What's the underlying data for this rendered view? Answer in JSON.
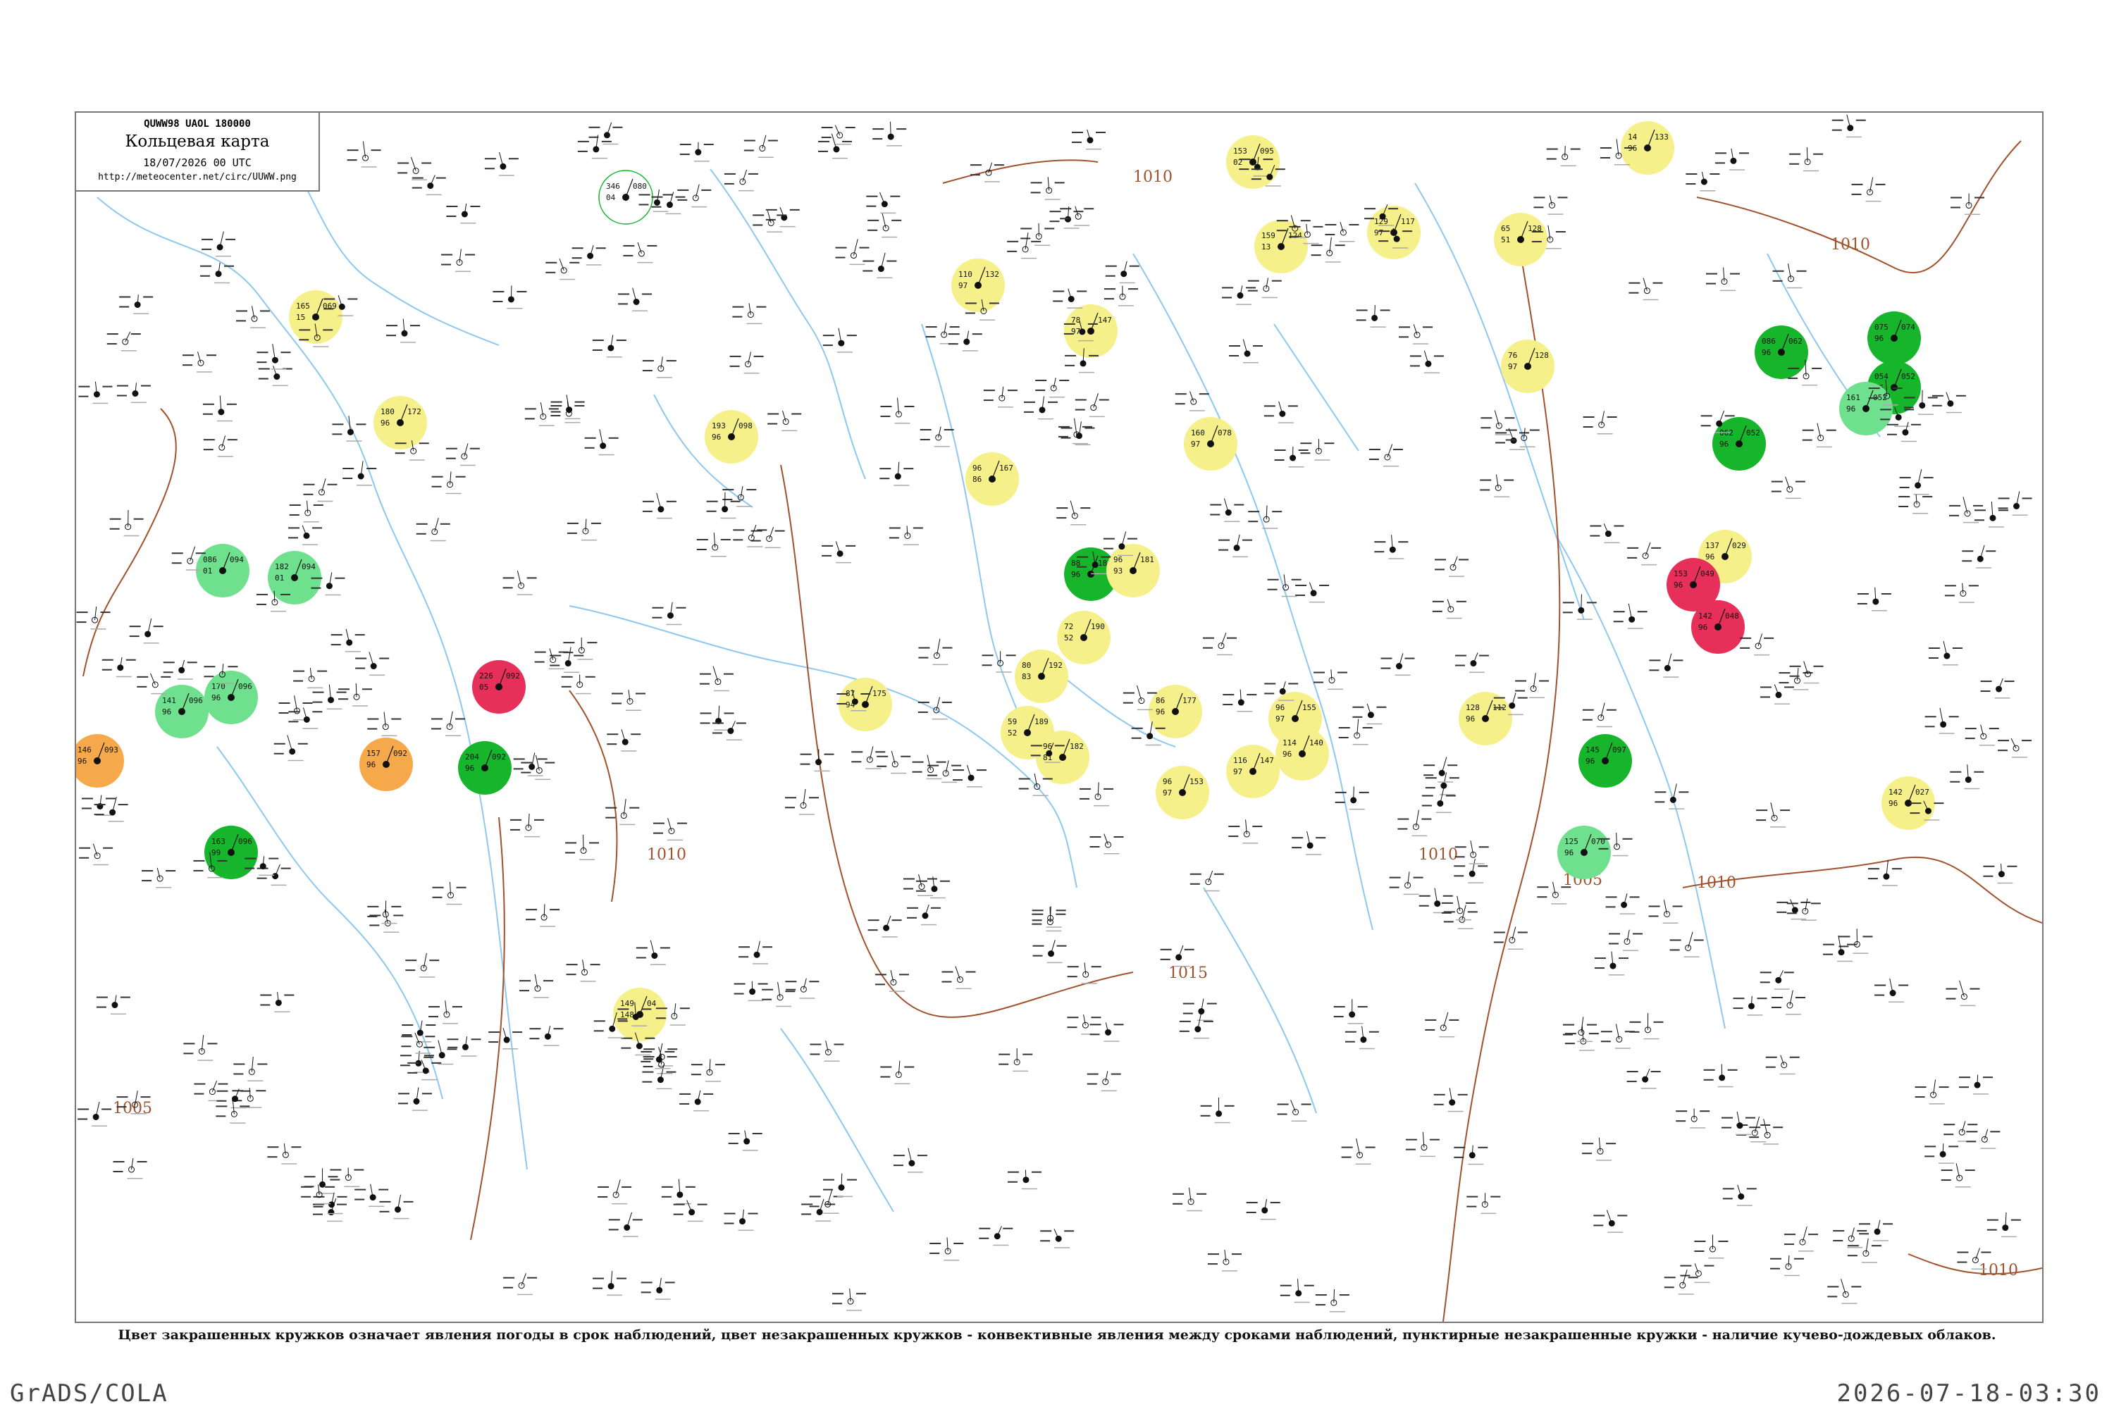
{
  "header": {
    "code": "QUWW98  UAOL  180000",
    "title": "Кольцевая карта",
    "date": "18/07/2026 00 UTC",
    "url": "http://meteocenter.net/circ/UUWW.png"
  },
  "caption": "Цвет закрашенных кружков означает явления погоды в срок наблюдений, цвет незакрашенных кружков - конвективные явления между сроками наблюдений, пунктирные незакрашенные кружки - наличие кучево-дождевых облаков.",
  "footer": {
    "left": "GrADS/COLA",
    "right": "2026-07-18-03:30"
  },
  "isobars": [
    "1010",
    "1010",
    "1005",
    "1010",
    "1015",
    "1010",
    "1005",
    "1010",
    "1010"
  ],
  "colors": {
    "yellow": "#f6f08a",
    "green": "#17b52c",
    "light_green": "#6fe08d",
    "orange": "#f6a94a",
    "red": "#e6305a",
    "isobar": "#a0522d",
    "river": "#8ec8ef"
  },
  "stations": [
    {
      "t": "165",
      "p": "069",
      "d": "15",
      "c": "yellow"
    },
    {
      "t": "180",
      "p": "172",
      "d": "96",
      "c": "yellow"
    },
    {
      "t": "346",
      "p": "080",
      "d": "04",
      "c": "none"
    },
    {
      "t": "153",
      "p": "095",
      "d": "02",
      "c": "yellow"
    },
    {
      "t": "14",
      "p": "133",
      "d": "96",
      "c": "yellow"
    },
    {
      "t": "159",
      "p": "124",
      "d": "13",
      "c": "yellow"
    },
    {
      "t": "129",
      "p": "117",
      "d": "97",
      "c": "yellow"
    },
    {
      "t": "65",
      "p": "128",
      "d": "51",
      "c": "yellow"
    },
    {
      "t": "110",
      "p": "132",
      "d": "97",
      "c": "yellow"
    },
    {
      "t": "78",
      "p": "147",
      "d": "97",
      "c": "yellow"
    },
    {
      "t": "193",
      "p": "098",
      "d": "96",
      "c": "yellow"
    },
    {
      "t": "88",
      "p": "182",
      "d": "96",
      "c": "green"
    },
    {
      "t": "086",
      "p": "094",
      "d": "01",
      "c": "light_green"
    },
    {
      "t": "182",
      "p": "094",
      "d": "01",
      "c": "light_green"
    },
    {
      "t": "226",
      "p": "092",
      "d": "05",
      "c": "red"
    },
    {
      "t": "146",
      "p": "093",
      "d": "96",
      "c": "orange"
    },
    {
      "t": "157",
      "p": "092",
      "d": "96",
      "c": "orange"
    },
    {
      "t": "204",
      "p": "092",
      "d": "96",
      "c": "green"
    },
    {
      "t": "163",
      "p": "096",
      "d": "99",
      "c": "green"
    },
    {
      "t": "96",
      "p": "167",
      "d": "86",
      "c": "yellow"
    },
    {
      "t": "96",
      "p": "181",
      "d": "93",
      "c": "yellow"
    },
    {
      "t": "72",
      "p": "190",
      "d": "52",
      "c": "yellow"
    },
    {
      "t": "80",
      "p": "192",
      "d": "83",
      "c": "yellow"
    },
    {
      "t": "59",
      "p": "189",
      "d": "52",
      "c": "yellow"
    },
    {
      "t": "96",
      "p": "182",
      "d": "81",
      "c": "yellow"
    },
    {
      "t": "87",
      "p": "175",
      "d": "94",
      "c": "yellow"
    },
    {
      "t": "86",
      "p": "177",
      "d": "96",
      "c": "yellow"
    },
    {
      "t": "96",
      "p": "155",
      "d": "97",
      "c": "yellow"
    },
    {
      "t": "128",
      "p": "112",
      "d": "96",
      "c": "yellow"
    },
    {
      "t": "114",
      "p": "140",
      "d": "96",
      "c": "yellow"
    },
    {
      "t": "116",
      "p": "147",
      "d": "97",
      "c": "yellow"
    },
    {
      "t": "96",
      "p": "153",
      "d": "97",
      "c": "yellow"
    },
    {
      "t": "149",
      "p": "04",
      "d": "148",
      "c": "yellow"
    },
    {
      "t": "160",
      "p": "078",
      "d": "97",
      "c": "yellow"
    },
    {
      "t": "76",
      "p": "128",
      "d": "97",
      "c": "yellow"
    },
    {
      "t": "137",
      "p": "029",
      "d": "96",
      "c": "yellow"
    },
    {
      "t": "142",
      "p": "027",
      "d": "96",
      "c": "yellow"
    },
    {
      "t": "075",
      "p": "074",
      "d": "96",
      "c": "green"
    },
    {
      "t": "086",
      "p": "062",
      "d": "96",
      "c": "green"
    },
    {
      "t": "062",
      "p": "052",
      "d": "96",
      "c": "green"
    },
    {
      "t": "054",
      "p": "052",
      "d": "96",
      "c": "green"
    },
    {
      "t": "161",
      "p": "052",
      "d": "96",
      "c": "light_green"
    },
    {
      "t": "142",
      "p": "048",
      "d": "96",
      "c": "red"
    },
    {
      "t": "153",
      "p": "049",
      "d": "96",
      "c": "red"
    },
    {
      "t": "125",
      "p": "070",
      "d": "96",
      "c": "light_green"
    },
    {
      "t": "145",
      "p": "097",
      "d": "96",
      "c": "green"
    },
    {
      "t": "141",
      "p": "096",
      "d": "96",
      "c": "light_green"
    },
    {
      "t": "170",
      "p": "096",
      "d": "96",
      "c": "light_green"
    }
  ]
}
